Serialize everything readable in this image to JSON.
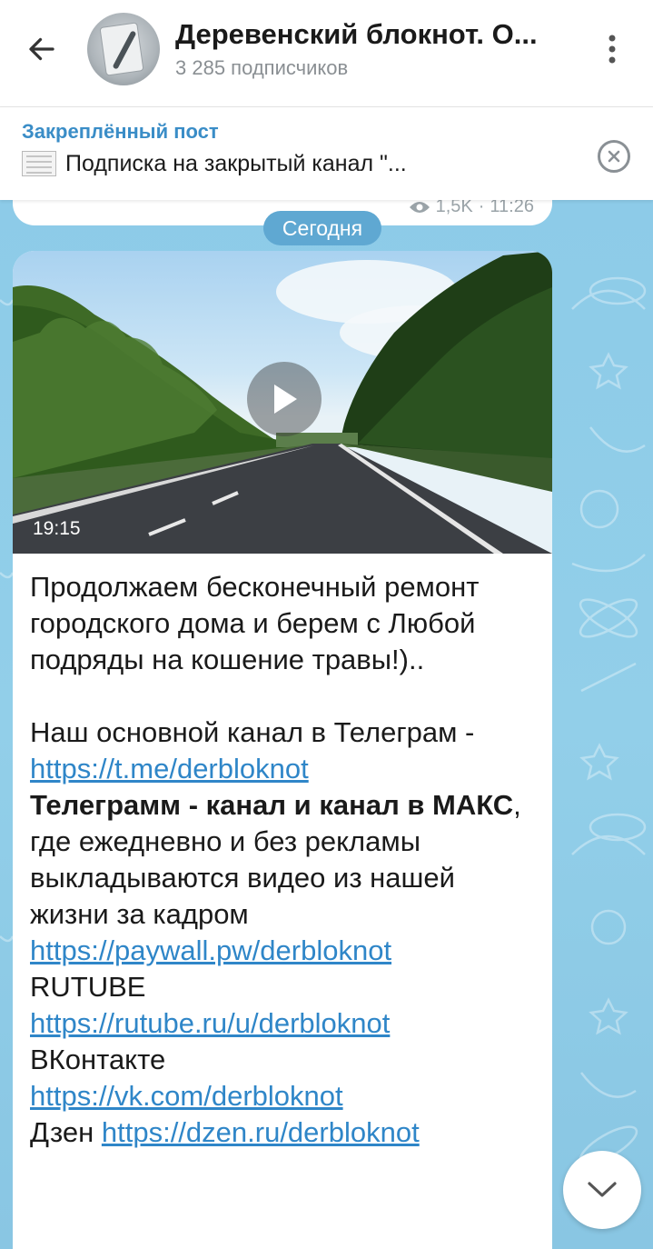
{
  "header": {
    "title": "Деревенский блокнот. О...",
    "subtitle": "3 285 подписчиков",
    "back_icon": "arrow-left-icon",
    "menu_icon": "more-vertical-icon"
  },
  "pinned": {
    "label": "Закреплённый пост",
    "text": "Подписка на закрытый канал \"...",
    "close_icon": "close-circle-icon"
  },
  "previous_message": {
    "views": "1,5K",
    "time": "11:26"
  },
  "date_separator": "Сегодня",
  "message": {
    "video_duration": "19:15",
    "paragraph1": "Продолжаем бесконечный ремонт городского дома и берем с Любой подряды на кошение травы!)..",
    "line_main_channel": "Наш основной канал в Телеграм -",
    "link1": "https://t.me/derbloknot",
    "bold_text": "Телеграмм - канал и канал в МАКС",
    "text_after_bold": ", где ежедневно и без рекламы выкладываются видео из нашей жизни за кадром",
    "link2": "https://paywall.pw/derbloknot",
    "label_rutube": "RUTUBE",
    "link3": "https://rutube.ru/u/derbloknot",
    "label_vk": "ВКонтакте",
    "link4": "https://vk.com/derbloknot",
    "label_dzen": "Дзен",
    "link5": "https://dzen.ru/derbloknot"
  },
  "colors": {
    "accent": "#3a8dc7",
    "link": "#2f86c8",
    "chat_background": "#8ec9e6",
    "date_pill": "#5fa8d2"
  },
  "scroll_icon": "chevron-down-icon"
}
